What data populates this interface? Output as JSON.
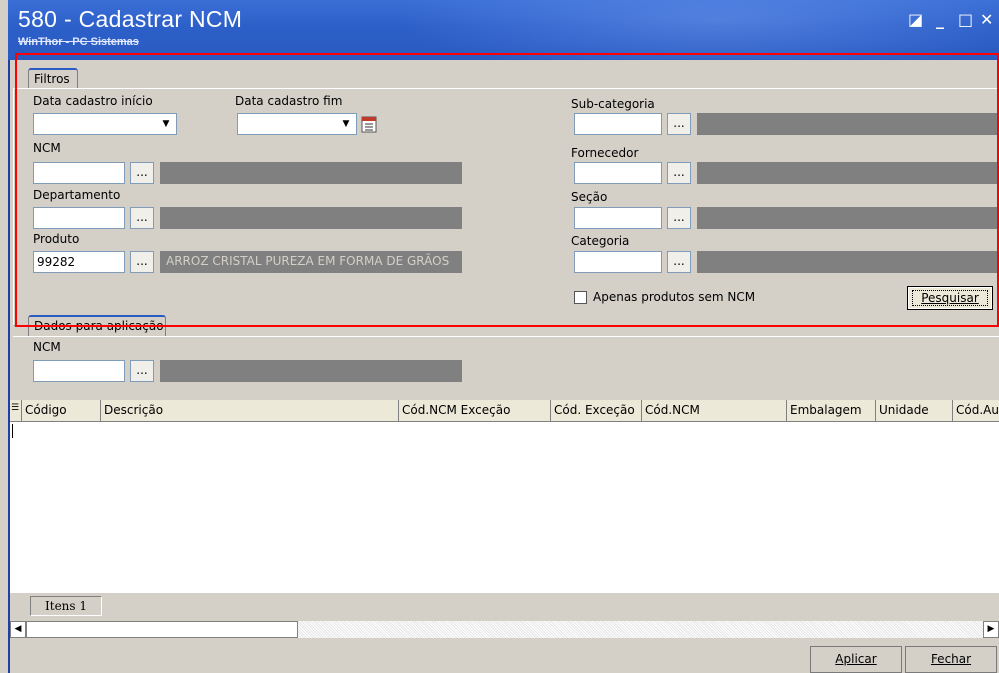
{
  "window": {
    "title": "580 - Cadastrar  NCM",
    "subtitle": "WinThor - PC Sistemas",
    "controls": {
      "restore": "◪",
      "minimize": "_",
      "maximize": "□",
      "close": "✕"
    }
  },
  "filtros": {
    "tab_label": "Filtros",
    "data_cadastro_inicio": {
      "label": "Data cadastro início",
      "value": ""
    },
    "data_cadastro_fim": {
      "label": "Data cadastro fim",
      "value": ""
    },
    "ncm": {
      "label": "NCM",
      "value": "",
      "description": ""
    },
    "departamento": {
      "label": "Departamento",
      "value": "",
      "description": ""
    },
    "produto": {
      "label": "Produto",
      "value": "99282",
      "description": "ARROZ  CRISTAL PUREZA EM FORMA DE GRÃOS"
    },
    "sub_categoria": {
      "label": "Sub-categoria",
      "value": "",
      "description": ""
    },
    "fornecedor": {
      "label": "Fornecedor",
      "value": "",
      "description": ""
    },
    "secao": {
      "label": "Seção",
      "value": "",
      "description": ""
    },
    "categoria": {
      "label": "Categoria",
      "value": "",
      "description": ""
    },
    "apenas_sem_ncm": {
      "label": "Apenas produtos sem NCM",
      "checked": false
    },
    "pesquisar_label": "Pesquisar",
    "dots": "..."
  },
  "aplicacao": {
    "tab_label": "Dados para aplicação",
    "ncm": {
      "label": "NCM",
      "value": "",
      "description": ""
    }
  },
  "grid": {
    "columns": [
      "Código",
      "Descrição",
      "Cód.NCM Exceção",
      "Cód. Exceção",
      "Cód.NCM",
      "Embalagem",
      "Unidade",
      "Cód.Au"
    ]
  },
  "status": {
    "itens": "Itens 1"
  },
  "footer": {
    "aplicar": "Aplicar",
    "fechar": "Fechar"
  },
  "colors": {
    "title_bg": "#2d5fc9",
    "highlight_box": "#ff0000",
    "panel_bg": "#d4d0c8"
  }
}
